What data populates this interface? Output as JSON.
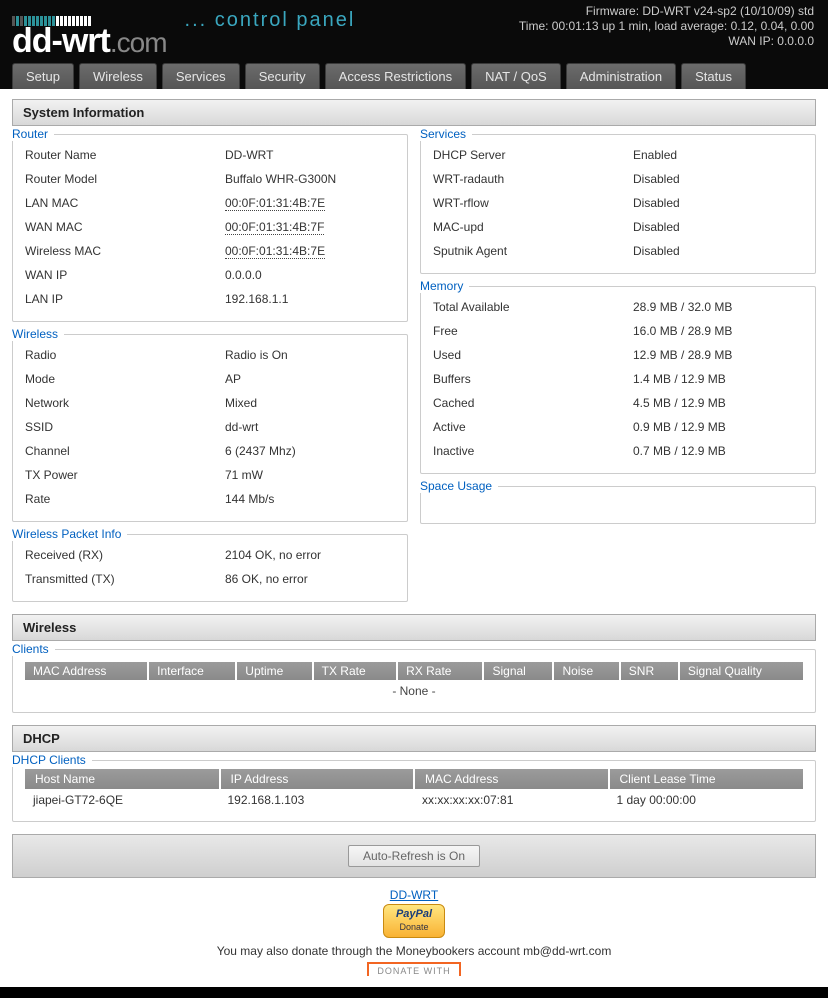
{
  "header": {
    "firmware": "Firmware: DD-WRT v24-sp2 (10/10/09) std",
    "time": "Time: 00:01:13 up 1 min, load average: 0.12, 0.04, 0.00",
    "wan_ip": "WAN IP: 0.0.0.0",
    "logo_main": "dd-wrt",
    "logo_com": ".com",
    "logo_sub": "... control panel"
  },
  "nav": [
    "Setup",
    "Wireless",
    "Services",
    "Security",
    "Access Restrictions",
    "NAT / QoS",
    "Administration",
    "Status"
  ],
  "sections": {
    "sysinfo": "System Information",
    "wireless_section": "Wireless",
    "dhcp_section": "DHCP"
  },
  "router": {
    "legend": "Router",
    "name_label": "Router Name",
    "name": "DD-WRT",
    "model_label": "Router Model",
    "model": "Buffalo WHR-G300N",
    "lan_mac_label": "LAN MAC",
    "lan_mac": "00:0F:01:31:4B:7E",
    "wan_mac_label": "WAN MAC",
    "wan_mac": "00:0F:01:31:4B:7F",
    "wl_mac_label": "Wireless MAC",
    "wl_mac": "00:0F:01:31:4B:7E",
    "wan_ip_label": "WAN IP",
    "wan_ip": "0.0.0.0",
    "lan_ip_label": "LAN IP",
    "lan_ip": "192.168.1.1"
  },
  "wireless": {
    "legend": "Wireless",
    "radio_label": "Radio",
    "radio": "Radio is On",
    "mode_label": "Mode",
    "mode": "AP",
    "network_label": "Network",
    "network": "Mixed",
    "ssid_label": "SSID",
    "ssid": "dd-wrt",
    "channel_label": "Channel",
    "channel": "6 (2437 Mhz)",
    "txpower_label": "TX Power",
    "txpower": "71 mW",
    "rate_label": "Rate",
    "rate": "144 Mb/s"
  },
  "packet": {
    "legend": "Wireless Packet Info",
    "rx_label": "Received (RX)",
    "rx": "2104 OK, no error",
    "tx_label": "Transmitted (TX)",
    "tx": "86 OK, no error"
  },
  "services": {
    "legend": "Services",
    "dhcp_label": "DHCP Server",
    "dhcp": "Enabled",
    "radauth_label": "WRT-radauth",
    "radauth": "Disabled",
    "rflow_label": "WRT-rflow",
    "rflow": "Disabled",
    "macupd_label": "MAC-upd",
    "macupd": "Disabled",
    "sputnik_label": "Sputnik Agent",
    "sputnik": "Disabled"
  },
  "memory": {
    "legend": "Memory",
    "total_label": "Total Available",
    "total": "28.9 MB / 32.0 MB",
    "free_label": "Free",
    "free": "16.0 MB / 28.9 MB",
    "used_label": "Used",
    "used": "12.9 MB / 28.9 MB",
    "buffers_label": "Buffers",
    "buffers": "1.4 MB / 12.9 MB",
    "cached_label": "Cached",
    "cached": "4.5 MB / 12.9 MB",
    "active_label": "Active",
    "active": "0.9 MB / 12.9 MB",
    "inactive_label": "Inactive",
    "inactive": "0.7 MB / 12.9 MB"
  },
  "space": {
    "legend": "Space Usage"
  },
  "clients": {
    "legend": "Clients",
    "headers": [
      "MAC Address",
      "Interface",
      "Uptime",
      "TX Rate",
      "RX Rate",
      "Signal",
      "Noise",
      "SNR",
      "Signal Quality"
    ],
    "none": "- None -"
  },
  "dhcp_clients": {
    "legend": "DHCP Clients",
    "headers": [
      "Host Name",
      "IP Address",
      "MAC Address",
      "Client Lease Time"
    ],
    "rows": [
      {
        "host": "jiapei-GT72-6QE",
        "ip": "192.168.1.103",
        "mac": "xx:xx:xx:xx:07:81",
        "lease": "1 day 00:00:00"
      }
    ]
  },
  "footer": {
    "auto_refresh": "Auto-Refresh is On",
    "ddwrt_link": "DD-WRT",
    "paypal_main": "PayPal",
    "paypal_sub": "Donate",
    "donate_text": "You may also donate through the Moneybookers account mb@dd-wrt.com",
    "donate_with": "DONATE WITH"
  }
}
